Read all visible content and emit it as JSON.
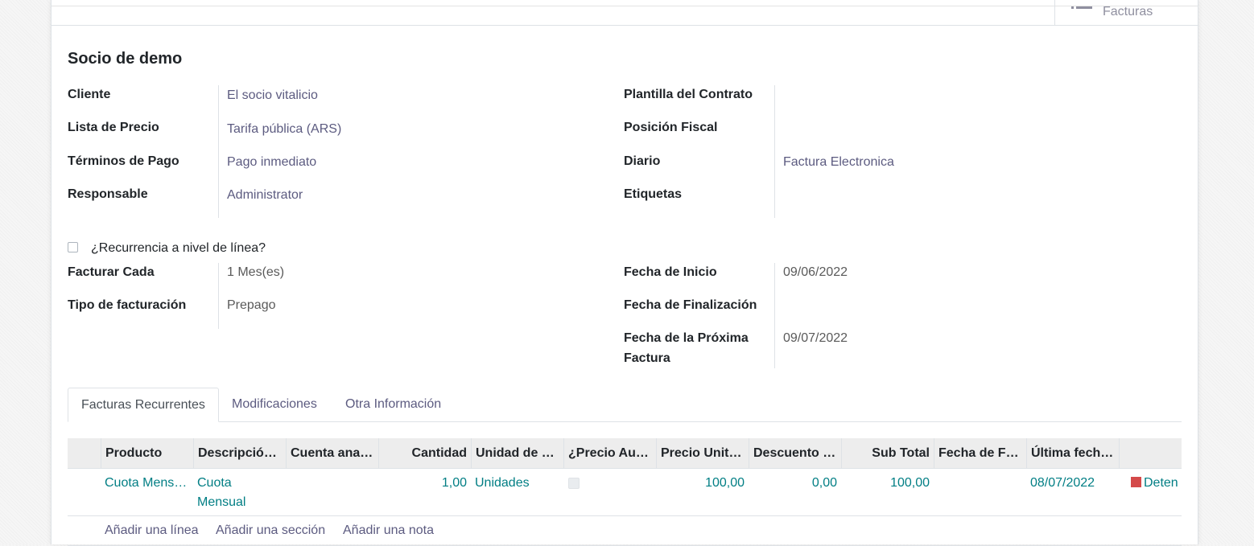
{
  "smart_button": {
    "label": "Facturas",
    "icon": "list-icon"
  },
  "partner_name": "Socio de demo",
  "left_fields": [
    {
      "label": "Cliente",
      "value": "El socio vitalicio"
    },
    {
      "label": "Lista de Precio",
      "value": "Tarifa pública (ARS)"
    },
    {
      "label": "Términos de Pago",
      "value": "Pago inmediato"
    },
    {
      "label": "Responsable",
      "value": "Administrator"
    }
  ],
  "right_fields": [
    {
      "label": "Plantilla del Contrato",
      "value": ""
    },
    {
      "label": "Posición Fiscal",
      "value": ""
    },
    {
      "label": "Diario",
      "value": "Factura Electronica"
    },
    {
      "label": "Etiquetas",
      "value": ""
    }
  ],
  "recurrence_checkbox": {
    "label": "¿Recurrencia a nivel de línea?",
    "checked": false
  },
  "recurrence_left": [
    {
      "label": "Facturar Cada",
      "value": "1 Mes(es)"
    },
    {
      "label": "Tipo de facturación",
      "value": "Prepago"
    }
  ],
  "recurrence_right": [
    {
      "label": "Fecha de Inicio",
      "value": "09/06/2022"
    },
    {
      "label": "Fecha de Finalización",
      "value": ""
    },
    {
      "label": "Fecha de la Próxima Factura",
      "value": "09/07/2022"
    }
  ],
  "tabs": [
    {
      "label": "Facturas Recurrentes",
      "active": true
    },
    {
      "label": "Modificaciones",
      "active": false
    },
    {
      "label": "Otra Información",
      "active": false
    }
  ],
  "grid": {
    "headers": [
      "Producto",
      "Descripció…",
      "Cuenta ana…",
      "Cantidad",
      "Unidad de …",
      "¿Precio Au…",
      "Precio Unit…",
      "Descuento …",
      "Sub Total",
      "Fecha de F…",
      "Última fech…"
    ],
    "rows": [
      {
        "producto": "Cuota Mens…",
        "descripcion": "Cuota Mensual",
        "cuenta": "",
        "cantidad": "1,00",
        "unidad": "Unidades",
        "precio_auto": false,
        "precio_unit": "100,00",
        "descuento": "0,00",
        "subtotal": "100,00",
        "fecha_f": "",
        "ultima_fecha": "08/07/2022",
        "status": "Deten"
      }
    ],
    "add_links": [
      "Añadir una línea",
      "Añadir una sección",
      "Añadir una nota"
    ]
  },
  "colors": {
    "link": "#5c5b80",
    "teal": "#017e84",
    "stop": "#d44a4a"
  }
}
